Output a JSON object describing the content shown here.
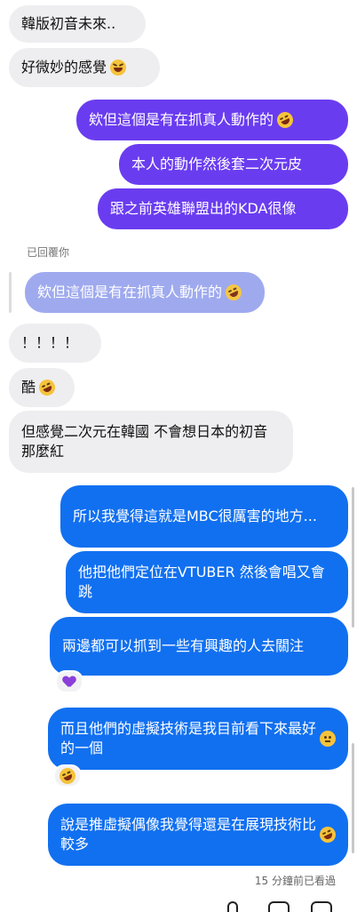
{
  "messages": [
    {
      "text": "韓版初音未來.."
    },
    {
      "text": "好微妙的感覺",
      "emoji": "grinning-squinting-emoji"
    },
    {
      "text": "欸但這個是有在抓真人動作的",
      "emoji": "rofl-emoji"
    },
    {
      "text": "本人的動作然後套二次元皮"
    },
    {
      "text": "跟之前英雄聯盟出的KDA很像"
    },
    {
      "text": "欸但這個是有在抓真人動作的",
      "emoji": "rofl-emoji"
    },
    {
      "text": "！！！！"
    },
    {
      "text": "酷",
      "emoji": "rofl-emoji"
    },
    {
      "text": "但感覺二次元在韓國 不會想日本的初音那麼紅"
    },
    {
      "text": "所以我覺得這就是MBC很厲害的地方..."
    },
    {
      "text": "他把他們定位在VTUBER 然後會唱又會跳"
    },
    {
      "text": "兩邊都可以抓到一些有興趣的人去關注"
    },
    {
      "text": "而且他們的虛擬技術是我目前看下來最好的一個",
      "emoji": "neutral-face-emoji"
    },
    {
      "text": "說是推虛擬偶像我覺得還是在展現技術比較多",
      "emoji": "rofl-emoji"
    }
  ],
  "reply_label": "已回覆你",
  "reactions": [
    {
      "icon": "purple-heart-icon"
    },
    {
      "icon": "rofl-emoji"
    }
  ],
  "seen_status": "15 分鐘前已看過",
  "colors": {
    "incoming": "#eeeef0",
    "outgoing_purple": "#6a3cf0",
    "outgoing_blue": "#1170f0",
    "quoted_reply": "#9aa6ee"
  }
}
